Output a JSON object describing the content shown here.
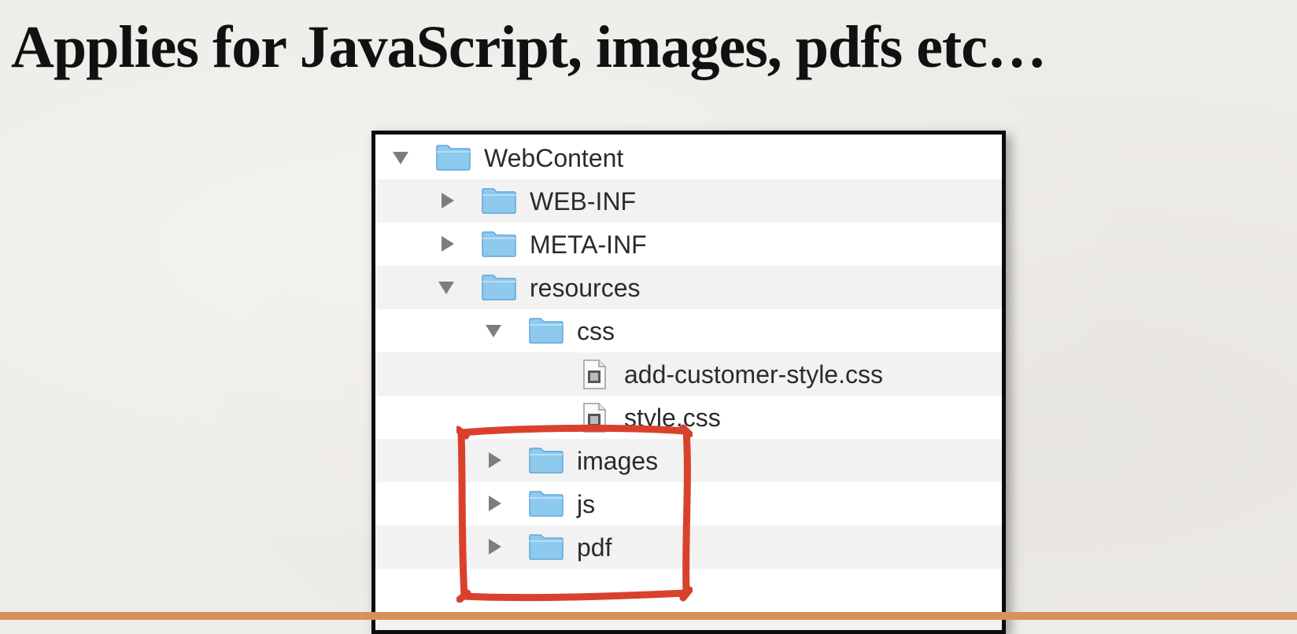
{
  "slide": {
    "title": "Applies for JavaScript, images, pdfs etc…"
  },
  "tree": {
    "items": [
      {
        "label": "WebContent",
        "type": "folder",
        "expanded": true,
        "depth": 0
      },
      {
        "label": "WEB-INF",
        "type": "folder",
        "expanded": false,
        "depth": 1
      },
      {
        "label": "META-INF",
        "type": "folder",
        "expanded": false,
        "depth": 1
      },
      {
        "label": "resources",
        "type": "folder",
        "expanded": true,
        "depth": 1
      },
      {
        "label": "css",
        "type": "folder",
        "expanded": true,
        "depth": 2
      },
      {
        "label": "add-customer-style.css",
        "type": "file",
        "depth": 3
      },
      {
        "label": "style.css",
        "type": "file",
        "depth": 3
      },
      {
        "label": "images",
        "type": "folder",
        "expanded": false,
        "depth": 2
      },
      {
        "label": "js",
        "type": "folder",
        "expanded": false,
        "depth": 2
      },
      {
        "label": "pdf",
        "type": "folder",
        "expanded": false,
        "depth": 2
      }
    ]
  },
  "colors": {
    "highlight": "#d9412c",
    "folder": "#8ec9ee",
    "accent_bar": "#d9905a"
  }
}
